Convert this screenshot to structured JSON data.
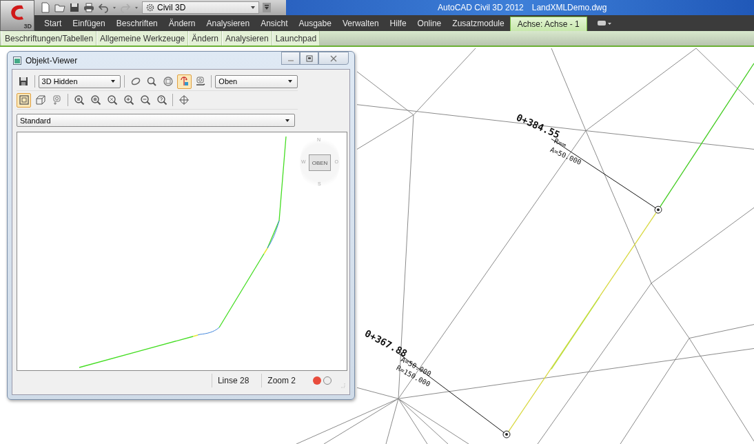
{
  "app": {
    "badge": "3D"
  },
  "quick_access": {
    "workspace": "Civil 3D"
  },
  "window": {
    "title": "AutoCAD Civil 3D 2012",
    "file": "LandXMLDemo.dwg"
  },
  "menu_tabs": [
    {
      "label": "Start",
      "selected": false
    },
    {
      "label": "Einfügen",
      "selected": false
    },
    {
      "label": "Beschriften",
      "selected": false
    },
    {
      "label": "Ändern",
      "selected": false
    },
    {
      "label": "Analysieren",
      "selected": false
    },
    {
      "label": "Ansicht",
      "selected": false
    },
    {
      "label": "Ausgabe",
      "selected": false
    },
    {
      "label": "Verwalten",
      "selected": false
    },
    {
      "label": "Hilfe",
      "selected": false
    },
    {
      "label": "Online",
      "selected": false
    },
    {
      "label": "Zusatzmodule",
      "selected": false
    },
    {
      "label": "Achse: Achse - 1",
      "selected": true
    }
  ],
  "ribbon_panels": [
    "Beschriftungen/Tabellen",
    "Allgemeine Werkzeuge",
    "Ändern",
    "Analysieren",
    "Launchpad"
  ],
  "viewer": {
    "title": "Objekt-Viewer",
    "visual_style": "3D Hidden",
    "view": "Oben",
    "style": "Standard",
    "tools_1": [
      {
        "selected": false
      },
      {
        "selected": false
      },
      {
        "selected": false
      },
      {
        "selected": true
      },
      {
        "selected": false
      }
    ],
    "tools_2": [
      {
        "selected": true
      },
      {
        "selected": false
      },
      {
        "selected": false
      }
    ],
    "compass": {
      "north": "N",
      "east": "O",
      "south": "S",
      "west": "W",
      "face": "OBEN"
    },
    "status": [
      "Linse 28",
      "Zoom 2"
    ]
  },
  "drawing": {
    "labels": [
      {
        "station": "0+384.55",
        "top": "R=∞",
        "bottom": "A=50.000"
      },
      {
        "station": "0+367.88",
        "top": "A=50.000",
        "bottom": "R=150.000"
      }
    ]
  }
}
